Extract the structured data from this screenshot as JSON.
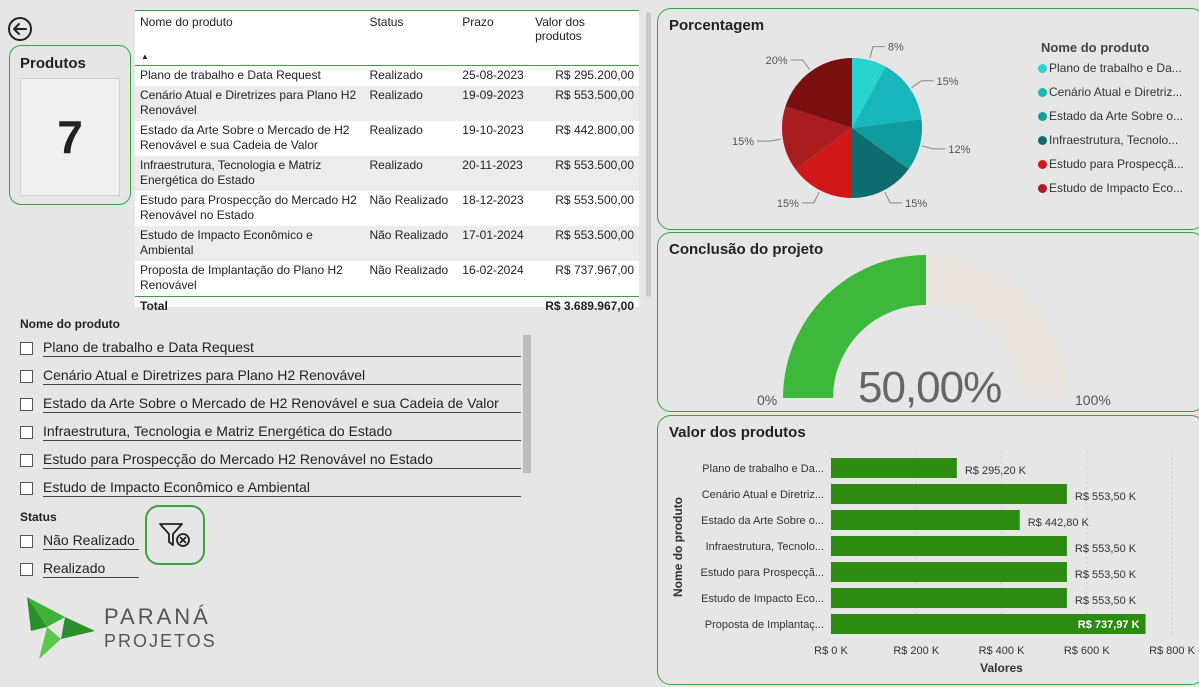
{
  "table": {
    "headers": [
      "Nome do produto",
      "Status",
      "Prazo",
      "Valor dos produtos"
    ],
    "rows": [
      {
        "nome": "Plano de trabalho e Data Request",
        "status": "Realizado",
        "prazo": "25-08-2023",
        "valor": "R$ 295.200,00"
      },
      {
        "nome": "Cenário Atual e Diretrizes para Plano H2 Renovável",
        "status": "Realizado",
        "prazo": "19-09-2023",
        "valor": "R$ 553.500,00"
      },
      {
        "nome": "Estado da Arte Sobre o Mercado de H2 Renovável e sua Cadeia de Valor",
        "status": "Realizado",
        "prazo": "19-10-2023",
        "valor": "R$ 442.800,00"
      },
      {
        "nome": "Infraestrutura, Tecnologia e Matriz Energética do Estado",
        "status": "Realizado",
        "prazo": "20-11-2023",
        "valor": "R$ 553.500,00"
      },
      {
        "nome": "Estudo para Prospecção do Mercado H2 Renovável no Estado",
        "status": "Não Realizado",
        "prazo": "18-12-2023",
        "valor": "R$ 553.500,00"
      },
      {
        "nome": "Estudo de Impacto Econômico e Ambiental",
        "status": "Não Realizado",
        "prazo": "17-01-2024",
        "valor": "R$ 553.500,00"
      },
      {
        "nome": "Proposta de Implantação do Plano H2 Renovável",
        "status": "Não Realizado",
        "prazo": "16-02-2024",
        "valor": "R$ 737.967,00"
      }
    ],
    "total_label": "Total",
    "total_value": "R$ 3.689.967,00"
  },
  "produtos": {
    "title": "Produtos",
    "count": "7"
  },
  "slicer_nome": {
    "title": "Nome do produto",
    "items": [
      "Plano de trabalho e Data Request",
      "Cenário Atual e Diretrizes para Plano H2 Renovável",
      "Estado da Arte Sobre o Mercado de H2 Renovável e sua Cadeia de Valor",
      "Infraestrutura, Tecnologia e Matriz Energética do Estado",
      "Estudo para Prospecção do Mercado H2 Renovável no Estado",
      "Estudo de Impacto Econômico e Ambiental"
    ]
  },
  "slicer_status": {
    "title": "Status",
    "items": [
      "Não Realizado",
      "Realizado"
    ]
  },
  "logo": {
    "line1": "PARANÁ",
    "line2": "PROJETOS"
  },
  "icons": {
    "back": "back-arrow-icon",
    "filter": "clear-filter-icon",
    "legend_more": "triangle-down-icon"
  },
  "pie": {
    "title": "Porcentagem",
    "legend_title": "Nome do produto",
    "legend": [
      {
        "label": "Plano de trabalho e Da...",
        "color": "#27d4d0"
      },
      {
        "label": "Cenário Atual e Diretriz...",
        "color": "#19b6bb"
      },
      {
        "label": "Estado da Arte Sobre o...",
        "color": "#109c9e"
      },
      {
        "label": "Infraestrutura, Tecnolo...",
        "color": "#0e6c70"
      },
      {
        "label": "Estudo para Prospecçã...",
        "color": "#d01818"
      },
      {
        "label": "Estudo de Impacto Eco...",
        "color": "#a91c1f"
      }
    ]
  },
  "gauge": {
    "title": "Conclusão do projeto",
    "value_text": "50,00%",
    "min": "0%",
    "max": "100%",
    "colors": {
      "fill": "#3db83a",
      "track": "#ebe5e0"
    }
  },
  "bars": {
    "title": "Valor dos produtos",
    "bar_color": "#2e8b12"
  },
  "chart_data": [
    {
      "type": "pie",
      "title": "Porcentagem",
      "categories": [
        "Plano de trabalho e Data Request",
        "Cenário Atual e Diretrizes para Plano H2 Renovável",
        "Estado da Arte Sobre o Mercado de H2 Renovável e sua Cadeia de Valor",
        "Infraestrutura, Tecnologia e Matriz Energética do Estado",
        "Estudo para Prospecção do Mercado H2 Renovável no Estado",
        "Estudo de Impacto Econômico e Ambiental",
        "Proposta de Implantação do Plano H2 Renovável"
      ],
      "values": [
        295200,
        553500,
        442800,
        553500,
        553500,
        553500,
        737967
      ],
      "labels": [
        "8%",
        "15%",
        "12%",
        "15%",
        "15%",
        "15%",
        "20%"
      ],
      "colors": [
        "#27d4d0",
        "#19b6bb",
        "#109c9e",
        "#0e6c70",
        "#d01818",
        "#a91c1f",
        "#7a0f10"
      ],
      "legend_position": "right"
    },
    {
      "type": "gauge",
      "title": "Conclusão do projeto",
      "value": 50,
      "min": 0,
      "max": 100
    },
    {
      "type": "bar",
      "orientation": "horizontal",
      "title": "Valor dos produtos",
      "categories": [
        "Plano de trabalho e Da...",
        "Cenário Atual e Diretriz...",
        "Estado da Arte Sobre o...",
        "Infraestrutura, Tecnolo...",
        "Estudo para Prospecçã...",
        "Estudo de Impacto Eco...",
        "Proposta de Implantaç..."
      ],
      "values": [
        295.2,
        553.5,
        442.8,
        553.5,
        553.5,
        553.5,
        737.97
      ],
      "data_labels": [
        "R$ 295,20 K",
        "R$ 553,50 K",
        "R$ 442,80 K",
        "R$ 553,50 K",
        "R$ 553,50 K",
        "R$ 553,50 K",
        "R$ 737,97 K"
      ],
      "xlabel": "Valores",
      "ylabel": "Nome do produto",
      "xlim": [
        0,
        800
      ],
      "xticks": [
        0,
        200,
        400,
        600,
        800
      ],
      "xtick_labels": [
        "R$ 0 K",
        "R$ 200 K",
        "R$ 400 K",
        "R$ 600 K",
        "R$ 800 K"
      ],
      "grid": true
    }
  ]
}
